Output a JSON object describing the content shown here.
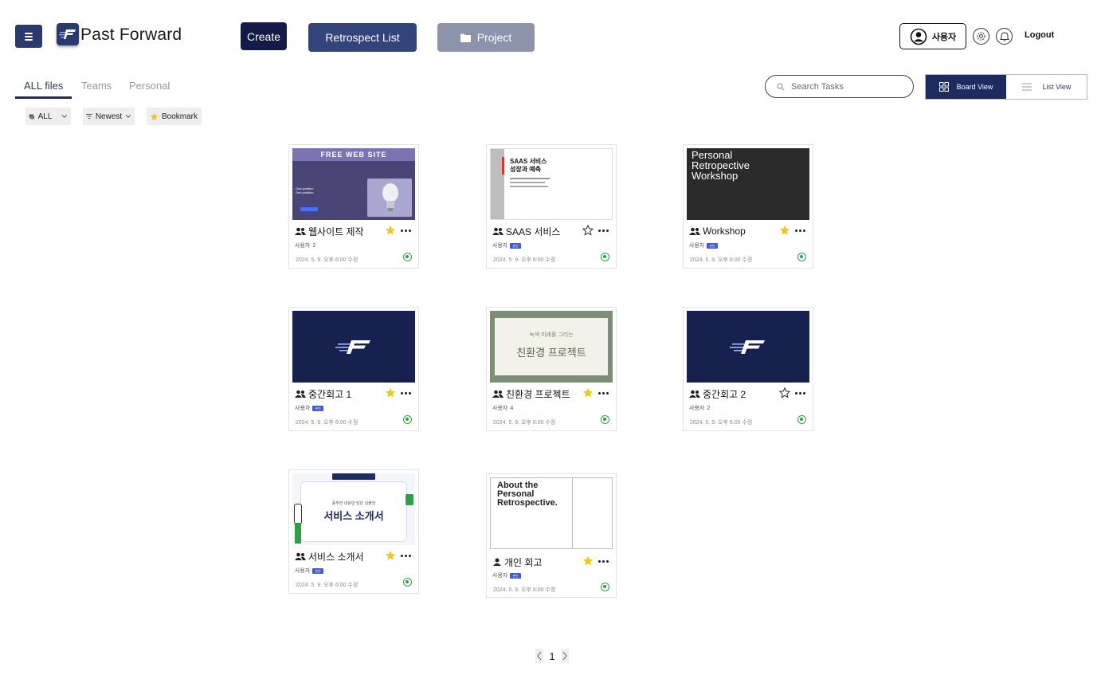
{
  "header": {
    "app_title": "Past Forward",
    "create_label": "Create",
    "retrospect_list_label": "Retrospect List",
    "project_label": "Project",
    "user_label": "사용자",
    "logout_label": "Logout"
  },
  "tabs": [
    {
      "label": "ALL files",
      "active": true
    },
    {
      "label": "Teams",
      "active": false
    },
    {
      "label": "Personal",
      "active": false
    }
  ],
  "search": {
    "placeholder": "Search Tasks"
  },
  "view_toggle": {
    "board_label": "Board View",
    "list_label": "List View",
    "selected": "board"
  },
  "filters": {
    "scope": "ALL",
    "sort": "Newest",
    "bookmark": "Bookmark"
  },
  "colors": {
    "primary": "#1e2b5e",
    "accent_star": "#f5c518",
    "status_green": "#2f9e44",
    "badge_blue": "#3a5bd9"
  },
  "thumbnails": {
    "web": {
      "heading": "FREE WEB SITE",
      "subtitle": "One position\nOne position"
    },
    "saas": {
      "heading": "SAAS 서비스\n성장과 예측"
    },
    "workshop": {
      "heading": "Personal\nRetropective\nWorkshop"
    },
    "eco": {
      "top": "녹색 미래를 그리는",
      "heading": "친환경 프로젝트"
    },
    "service": {
      "top": "풍부한 내용만 담은 심플한",
      "heading": "서비스 소개서"
    },
    "about": {
      "heading": "About the\nPersonal\nRetrospective."
    }
  },
  "cards": [
    {
      "title": "웹사이트 제작",
      "type": "team",
      "owner": "사용자",
      "suffix": "2",
      "badge": "",
      "date": "2024. 5. 9. 오후 6:00 수정",
      "bookmarked": true
    },
    {
      "title": "SAAS 서비스",
      "type": "team",
      "owner": "사용자",
      "suffix": "",
      "badge": "본인",
      "date": "2024. 5. 9. 오후 6:00 수정",
      "bookmarked": false
    },
    {
      "title": "Workshop",
      "type": "team",
      "owner": "사용자",
      "suffix": "",
      "badge": "본인",
      "date": "2024. 5. 9. 오후 6:00 수정",
      "bookmarked": true
    },
    {
      "title": "중간회고 1",
      "type": "team",
      "owner": "사용자",
      "suffix": "",
      "badge": "본인",
      "date": "2024. 5. 9. 오후 6:00 수정",
      "bookmarked": true
    },
    {
      "title": "친환경 프로젝트",
      "type": "team",
      "owner": "사용자",
      "suffix": "4",
      "badge": "",
      "date": "2024. 5. 9. 오후 6:00 수정",
      "bookmarked": true
    },
    {
      "title": "중간회고 2",
      "type": "team",
      "owner": "사용자",
      "suffix": "2",
      "badge": "",
      "date": "2024. 5. 9. 오후 6:00 수정",
      "bookmarked": false
    },
    {
      "title": "서비스 소개서",
      "type": "team",
      "owner": "사용자",
      "suffix": "",
      "badge": "본인",
      "date": "2024. 5. 9. 오후 6:00 수정",
      "bookmarked": true
    },
    {
      "title": "개인 회고",
      "type": "personal",
      "owner": "사용자",
      "suffix": "",
      "badge": "본인",
      "date": "2024. 5. 9. 오후 6:00 수정",
      "bookmarked": true
    }
  ],
  "pagination": {
    "current": "1"
  }
}
